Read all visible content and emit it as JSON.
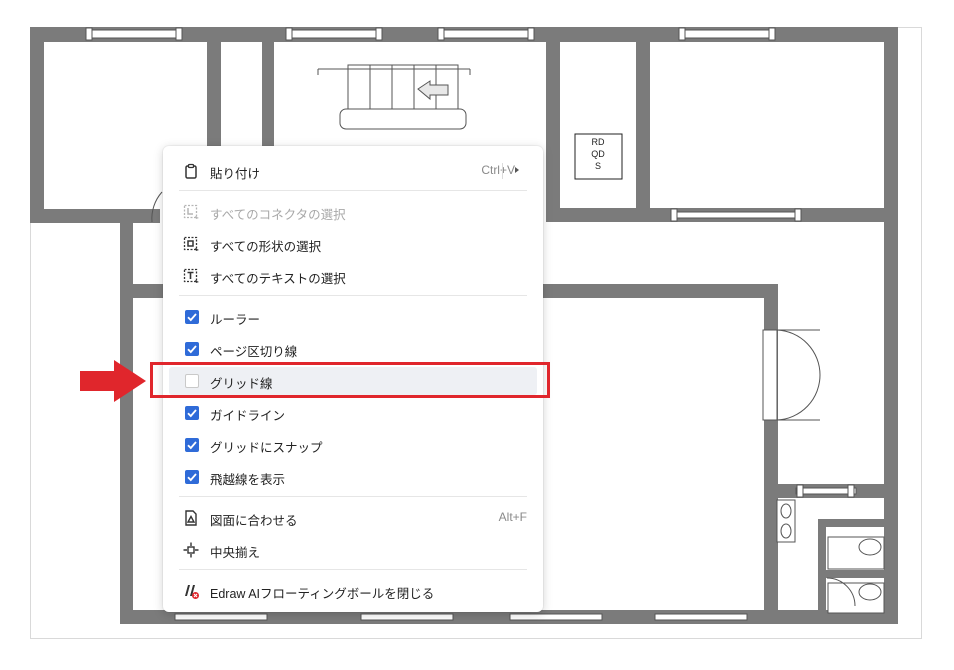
{
  "floorplan": {
    "stair_marker_label": "RD QD S"
  },
  "context_menu": {
    "items": [
      {
        "label": "貼り付け",
        "shortcut": "Ctrl+V",
        "icon": "clipboard-icon",
        "enabled": true
      },
      {
        "label": "すべてのコネクタの選択",
        "icon": "select-connectors-icon",
        "enabled": false
      },
      {
        "label": "すべての形状の選択",
        "icon": "select-shapes-icon",
        "enabled": true
      },
      {
        "label": "すべてのテキストの選択",
        "icon": "select-text-icon",
        "enabled": true
      },
      {
        "label": "ルーラー",
        "checked": true
      },
      {
        "label": "ページ区切り線",
        "checked": true
      },
      {
        "label": "グリッド線",
        "checked": false
      },
      {
        "label": "ガイドライン",
        "checked": true
      },
      {
        "label": "グリッドにスナップ",
        "checked": true
      },
      {
        "label": "飛越線を表示",
        "checked": true
      },
      {
        "label": "図面に合わせる",
        "shortcut": "Alt+F",
        "icon": "fit-to-drawing-icon"
      },
      {
        "label": "中央揃え",
        "icon": "center-align-icon"
      },
      {
        "label": "Edraw AIフローティングボールを閉じる",
        "icon": "edraw-ai-icon"
      }
    ]
  },
  "colors": {
    "wall": "#7b7b7b",
    "checkbox": "#2f6bd8",
    "annotation": "#e0262c"
  }
}
